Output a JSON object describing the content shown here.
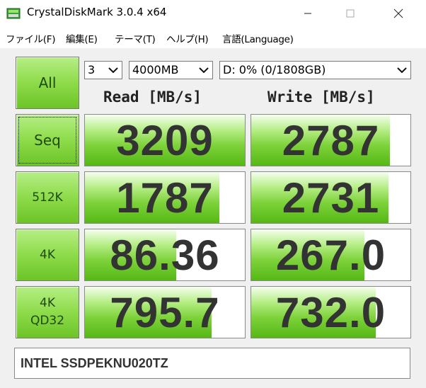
{
  "window": {
    "title": "CrystalDiskMark 3.0.4 x64"
  },
  "menu": [
    "ファイル(F)",
    "編集(E)",
    "テーマ(T)",
    "ヘルプ(H)",
    "言語(Language)"
  ],
  "controls": {
    "all_label": "All",
    "count": "3",
    "size": "4000MB",
    "drive": "D: 0% (0/1808GB)"
  },
  "headers": {
    "read": "Read [MB/s]",
    "write": "Write [MB/s]"
  },
  "rows": [
    {
      "label": "Seq",
      "read": "3209",
      "write": "2787",
      "read_fill": 1.0,
      "write_fill": 0.87
    },
    {
      "label": "512K",
      "read": "1787",
      "write": "2731",
      "read_fill": 0.84,
      "write_fill": 0.86
    },
    {
      "label": "4K",
      "read": "86.36",
      "write": "267.0",
      "read_fill": 0.57,
      "write_fill": 0.71
    },
    {
      "label": "4K\nQD32",
      "read": "795.7",
      "write": "732.0",
      "read_fill": 0.79,
      "write_fill": 0.78
    }
  ],
  "comment": "INTEL SSDPEKNU020TZ"
}
